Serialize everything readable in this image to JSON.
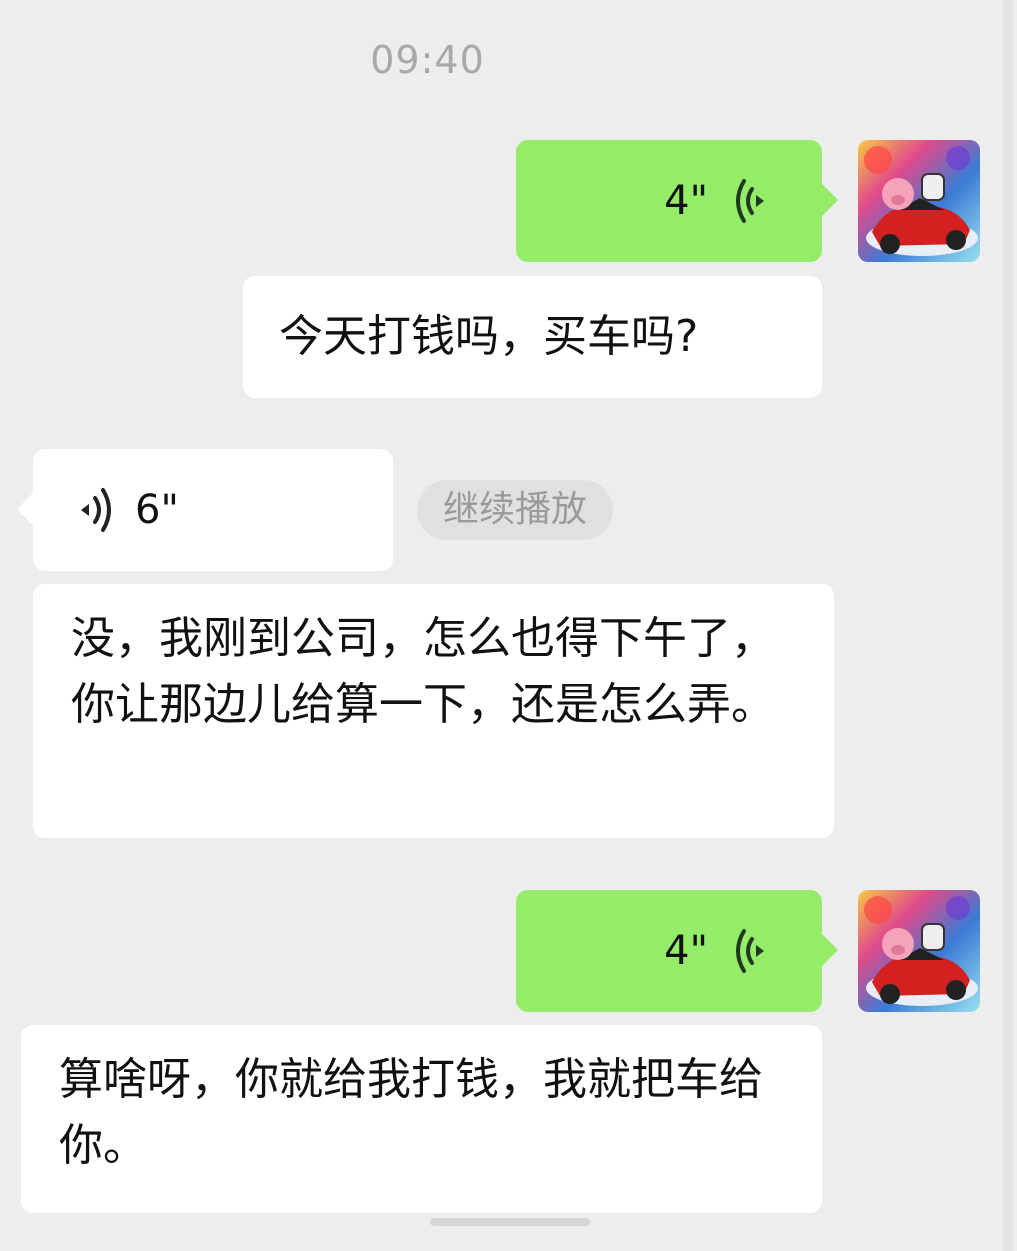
{
  "timestamp": "09:40",
  "messages": [
    {
      "side": "right",
      "type": "voice",
      "duration": "4\""
    },
    {
      "side": "right",
      "type": "text",
      "text": "今天打钱吗，买车吗?"
    },
    {
      "side": "left",
      "type": "voice",
      "duration": "6\"",
      "action": "继续播放"
    },
    {
      "side": "left",
      "type": "text",
      "text": "没，我刚到公司，怎么也得下午了，你让那边儿给算一下，还是怎么弄。"
    },
    {
      "side": "right",
      "type": "voice",
      "duration": "4\""
    },
    {
      "side": "left",
      "type": "text",
      "text": "算啥呀，你就给我打钱，我就把车给你。"
    }
  ],
  "colors": {
    "background": "#ededed",
    "outgoing_bubble": "#95ec69",
    "incoming_bubble": "#ffffff",
    "voice_icon_outgoing": "#1a7a1a"
  },
  "icons": {
    "voice_outgoing": "voice-wave-icon",
    "voice_incoming": "voice-wave-icon",
    "avatar": "pig-car-avatar"
  }
}
